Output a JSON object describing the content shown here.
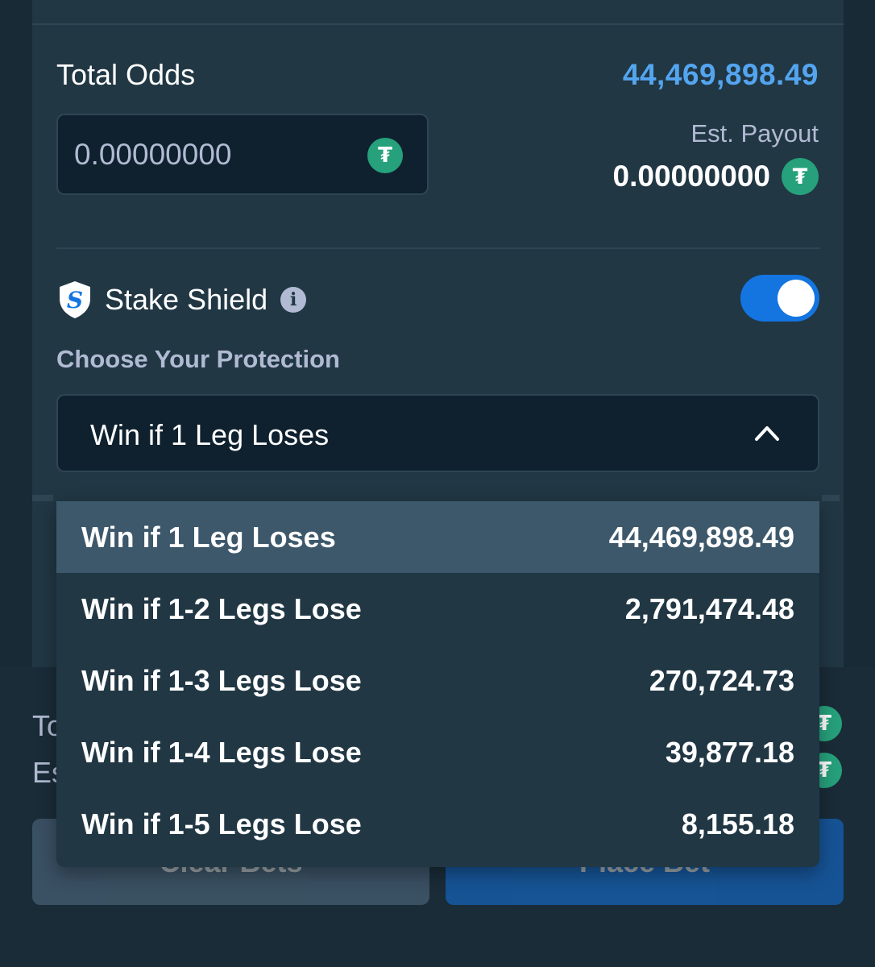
{
  "bet": {
    "total_odds_label": "Total Odds",
    "total_odds_value": "44,469,898.49",
    "stake_placeholder": "0.00000000",
    "payout_label": "Est. Payout",
    "payout_value": "0.00000000",
    "currency_icon": "tether-icon"
  },
  "shield": {
    "label": "Stake Shield",
    "enabled": true,
    "protection_label": "Choose Your Protection",
    "selected": "Win if 1 Leg Loses"
  },
  "options": [
    {
      "label": "Win if 1 Leg Loses",
      "odds": "44,469,898.49",
      "selected": true
    },
    {
      "label": "Win if 1-2 Legs Lose",
      "odds": "2,791,474.48",
      "selected": false
    },
    {
      "label": "Win if 1-3 Legs Lose",
      "odds": "270,724.73",
      "selected": false
    },
    {
      "label": "Win if 1-4 Legs Lose",
      "odds": "39,877.18",
      "selected": false
    },
    {
      "label": "Win if 1-5 Legs Lose",
      "odds": "8,155.18",
      "selected": false
    }
  ],
  "footer": {
    "total_partial": "To",
    "est_partial": "Es",
    "clear_label": "Clear Bets",
    "place_label": "Place Bet"
  },
  "colors": {
    "accent": "#1475e1",
    "odds": "#54a5f0",
    "tether": "#26a17b",
    "panel": "#213744",
    "input": "#0f212e"
  }
}
